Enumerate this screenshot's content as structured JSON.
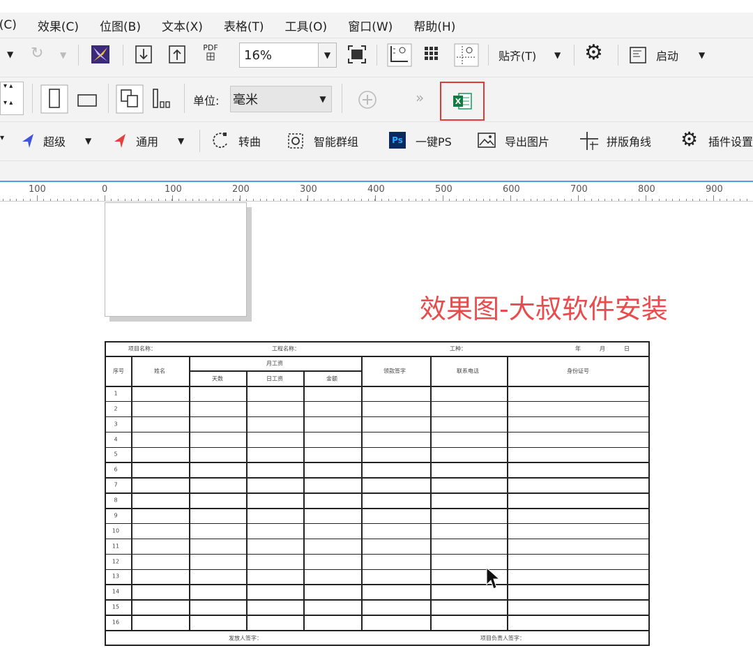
{
  "menu": [
    "E(C)",
    "效果(C)",
    "位图(B)",
    "文本(X)",
    "表格(T)",
    "工具(O)",
    "窗口(W)",
    "帮助(H)"
  ],
  "toolbar1": {
    "pdf_label": "PDF",
    "zoom": "16%",
    "align_label": "贴齐(T)",
    "launch_label": "启动"
  },
  "toolbar2": {
    "unit_label": "单位:",
    "unit_value": "毫米"
  },
  "toolbar3": {
    "super_label": "超级",
    "general_label": "通用",
    "convert_curve": "转曲",
    "smart_group": "智能群组",
    "ps_badge": "Ps",
    "one_click_ps": "一键PS",
    "export_image": "导出图片",
    "imposition": "拼版角线",
    "plugin_settings": "插件设置"
  },
  "ruler": {
    "labels": [
      "100",
      "0",
      "100",
      "200",
      "300",
      "400",
      "500",
      "600",
      "700",
      "800",
      "900"
    ]
  },
  "watermark": "效果图-大叔软件安装",
  "table": {
    "header_info": [
      "项目名称：",
      "工程名称：",
      "工种：",
      "年",
      "月",
      "日"
    ],
    "col_headers": [
      "序号",
      "姓名",
      "天数",
      "日工资",
      "金额",
      "领款签字",
      "联系电话",
      "身份证号"
    ],
    "group_header": "月工资",
    "row_numbers": [
      "1",
      "2",
      "3",
      "4",
      "5",
      "6",
      "7",
      "8",
      "9",
      "10",
      "11",
      "12",
      "13",
      "14",
      "15",
      "16"
    ],
    "footer_left": "发放人签字：",
    "footer_right": "项目负责人签字："
  }
}
